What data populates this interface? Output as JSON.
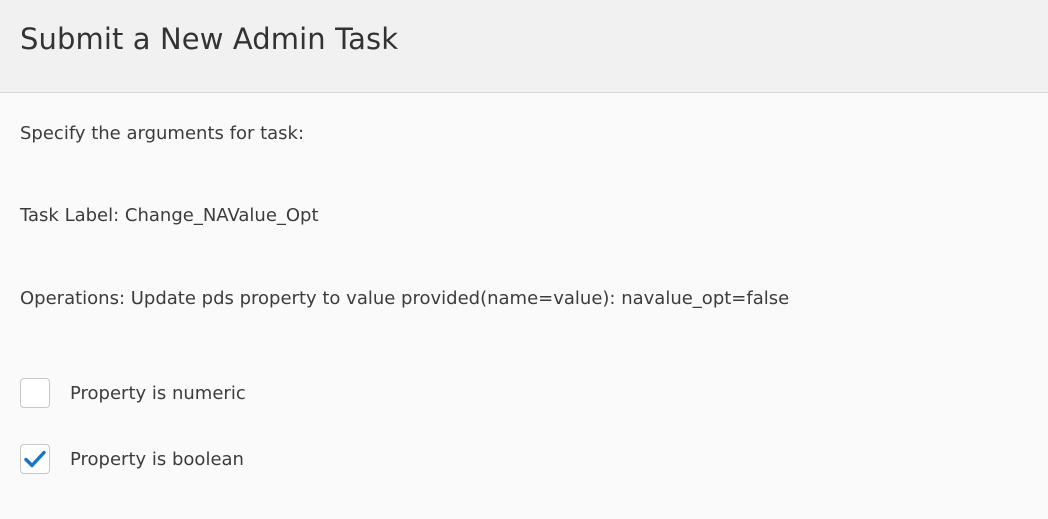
{
  "dialog": {
    "title": "Submit a New Admin Task"
  },
  "body": {
    "instruction": "Specify the arguments for task:",
    "task_label": "Task Label: Change_NAValue_Opt",
    "operations": "Operations: Update pds property to value provided(name=value): navalue_opt=false"
  },
  "options": [
    {
      "label": "Property is numeric",
      "checked": false
    },
    {
      "label": "Property is boolean",
      "checked": true
    }
  ],
  "colors": {
    "check_accent": "#1a73c7",
    "header_bg": "#f1f1f1",
    "body_bg": "#fafafa"
  },
  "icons": {
    "checked": "checkmark-icon"
  }
}
